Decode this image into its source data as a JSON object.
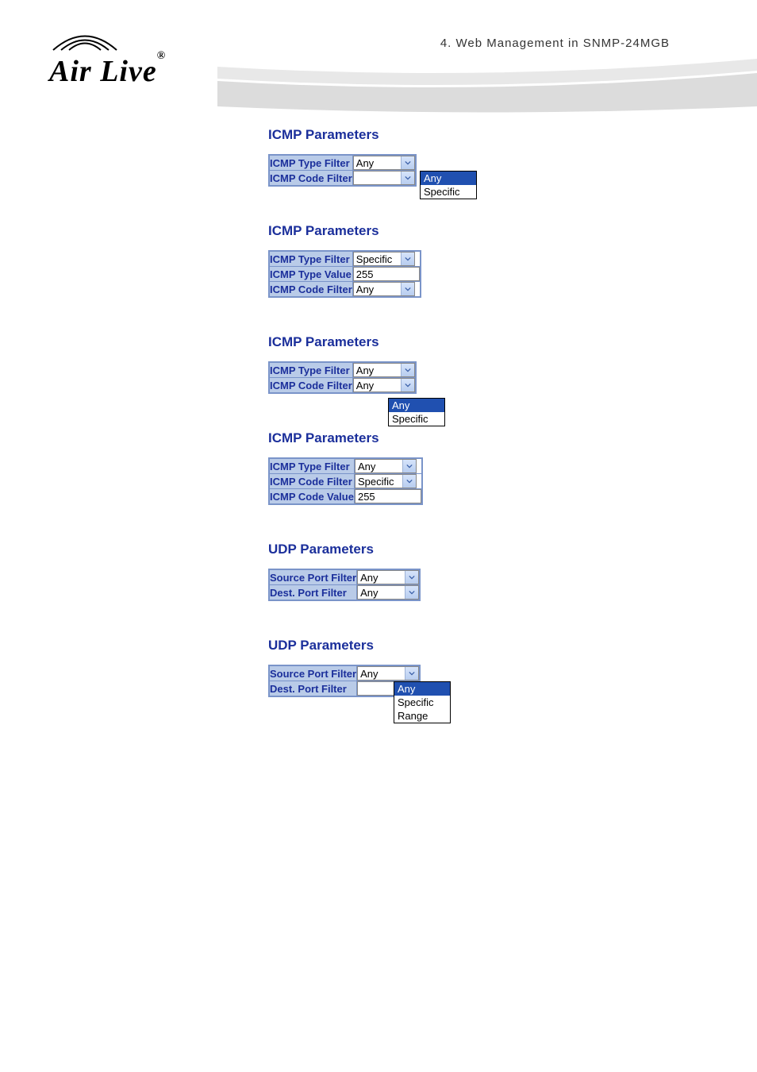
{
  "header": {
    "breadcrumb": "4.  Web Management  in  SNMP-24MGB"
  },
  "logo": {
    "brand": "Air Live",
    "reg": "®"
  },
  "sections": [
    {
      "title": "ICMP Parameters",
      "rows": [
        {
          "label": "ICMP Type Filter",
          "type": "select",
          "value": "Any"
        },
        {
          "label": "ICMP Code Filter",
          "type": "select-open",
          "value": "Any",
          "options": [
            "Any",
            "Specific"
          ],
          "selected": "Any"
        }
      ]
    },
    {
      "title": "ICMP Parameters",
      "rows": [
        {
          "label": "ICMP Type Filter",
          "type": "select",
          "value": "Specific"
        },
        {
          "label": "ICMP Type Value",
          "type": "text",
          "value": "255"
        },
        {
          "label": "ICMP Code Filter",
          "type": "select",
          "value": "Any"
        }
      ]
    },
    {
      "title": "ICMP Parameters",
      "rows": [
        {
          "label": "ICMP Type Filter",
          "type": "select",
          "value": "Any"
        },
        {
          "label": "ICMP Code Filter",
          "type": "select",
          "value": "Any",
          "open_below": true,
          "options": [
            "Any",
            "Specific"
          ],
          "selected": "Any"
        }
      ]
    },
    {
      "title": "ICMP Parameters",
      "rows": [
        {
          "label": "ICMP Type Filter",
          "type": "select",
          "value": "Any"
        },
        {
          "label": "ICMP Code Filter",
          "type": "select",
          "value": "Specific"
        },
        {
          "label": "ICMP Code Value",
          "type": "text",
          "value": "255"
        }
      ]
    },
    {
      "title": "UDP Parameters",
      "rows": [
        {
          "label": "Source Port Filter",
          "type": "select",
          "value": "Any"
        },
        {
          "label": "Dest. Port Filter",
          "type": "select",
          "value": "Any"
        }
      ]
    },
    {
      "title": "UDP Parameters",
      "rows": [
        {
          "label": "Source Port Filter",
          "type": "select",
          "value": "Any"
        },
        {
          "label": "Dest. Port Filter",
          "type": "select-open",
          "value": "Any",
          "options": [
            "Any",
            "Specific",
            "Range"
          ],
          "selected": "Any"
        }
      ]
    }
  ]
}
